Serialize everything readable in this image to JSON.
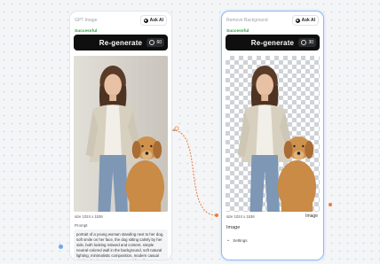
{
  "nodes": [
    {
      "title": "GPT Image",
      "ask_ai": "Ask AI",
      "status": "Successful",
      "button": "Re-generate",
      "credits": "60",
      "image_size": "size 1024 x 1536",
      "prompt_label": "Prompt",
      "prompt": "portrait of a young woman standing next to her dog, soft smile on her face, the dog sitting calmly by her side, both looking relaxed and content, simple neutral-colored wall in the background, soft natural lighting, minimalistic composition, modern casual clothing for the woman, warm and friendly atmosphere, high detail, realistic textures"
    },
    {
      "title": "Remove Background",
      "ask_ai": "Ask AI",
      "status": "Successful",
      "button": "Re-generate",
      "credits": "30",
      "image_size": "size 1024 x 1536",
      "image_tag": "Image",
      "output_label": "Image",
      "settings_label": "Settings"
    }
  ],
  "connector_label": "1",
  "colors": {
    "success": "#2f9e44",
    "connector": "#f07a3a",
    "selected_border": "#8fb6ea"
  },
  "icons": [
    "sparkle-icon",
    "coin-icon",
    "chevron-down-icon"
  ]
}
